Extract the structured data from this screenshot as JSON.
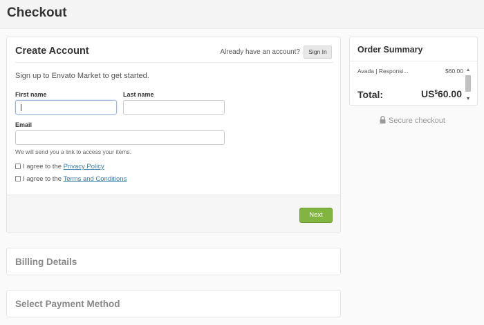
{
  "page": {
    "title": "Checkout"
  },
  "create_account": {
    "title": "Create Account",
    "already_text": "Already have an account?",
    "signin_label": "Sign In",
    "intro": "Sign up to Envato Market to get started.",
    "first_name_label": "First name",
    "first_name_value": "",
    "last_name_label": "Last name",
    "last_name_value": "",
    "email_label": "Email",
    "email_value": "",
    "email_hint": "We will send you a link to access your items.",
    "agree_prefix": "I agree to the",
    "privacy_link": "Privacy Policy",
    "terms_link": "Terms and Conditions",
    "next_label": "Next"
  },
  "billing": {
    "title": "Billing Details"
  },
  "payment": {
    "title": "Select Payment Method"
  },
  "order_summary": {
    "title": "Order Summary",
    "item_name": "Avada | Responsi...",
    "item_price": "$60.00",
    "total_label": "Total:",
    "total_currency_prefix": "US",
    "total_currency_symbol": "$",
    "total_amount": "60.00"
  },
  "secure_text": "Secure checkout",
  "icons": {
    "lock": "lock-icon",
    "scroll_up": "scroll-up-arrow-icon",
    "scroll_down": "scroll-down-arrow-icon"
  },
  "colors": {
    "accent_green": "#82b540",
    "link_blue": "#3a7fa8"
  }
}
